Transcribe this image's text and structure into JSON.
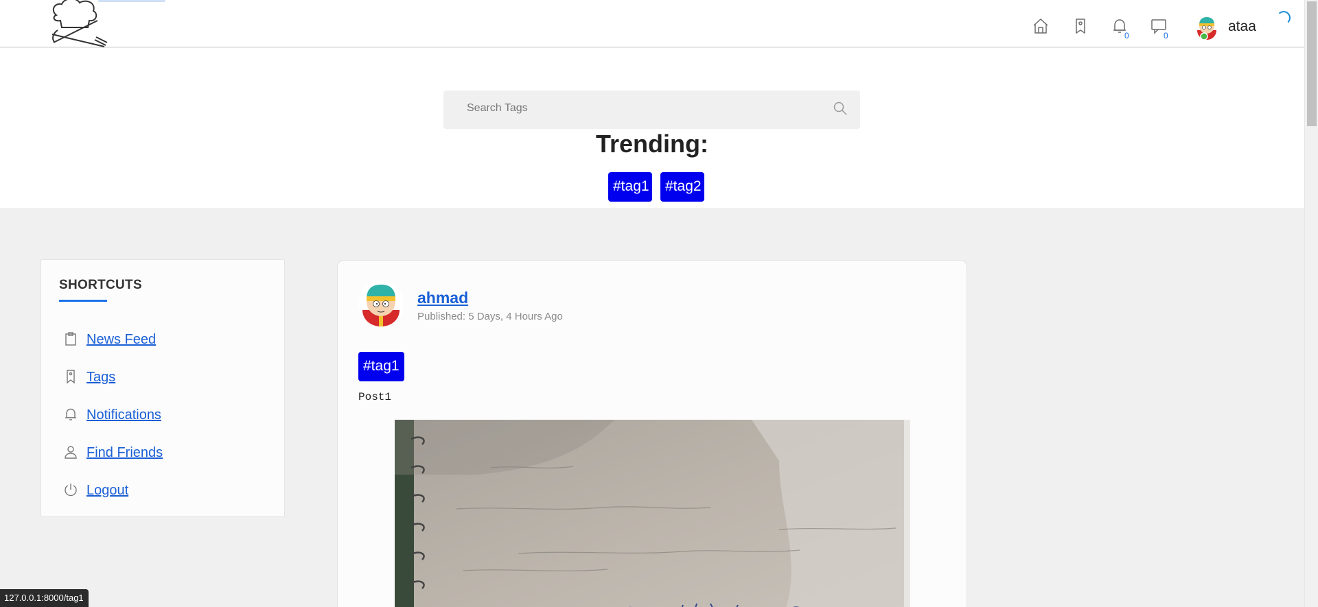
{
  "header": {
    "nav": {
      "home_icon": "home-icon",
      "tags_icon": "tag-icon",
      "notifications_icon": "bell-icon",
      "notifications_count": "0",
      "messages_icon": "chat-icon",
      "messages_count": "0"
    },
    "user": {
      "name": "ataa"
    }
  },
  "search": {
    "placeholder": "Search Tags"
  },
  "trending": {
    "title": "Trending:",
    "tags": [
      "#tag1",
      "#tag2"
    ]
  },
  "sidebar": {
    "title": "SHORTCUTS",
    "items": [
      {
        "label": "News Feed",
        "icon": "clipboard-icon"
      },
      {
        "label": "Tags",
        "icon": "tag-icon"
      },
      {
        "label": "Notifications",
        "icon": "bell-icon"
      },
      {
        "label": "Find Friends",
        "icon": "user-icon"
      },
      {
        "label": "Logout",
        "icon": "power-icon"
      }
    ]
  },
  "post": {
    "author": "ahmad",
    "published": "Published: 5 Days, 4 Hours Ago",
    "tag": "#tag1",
    "text": "Post1"
  },
  "status_bar": {
    "url": "127.0.0.1:8000/tag1"
  },
  "colors": {
    "accent": "#0000ee",
    "link": "#1a5fd6",
    "background": "#f1f0f0"
  }
}
